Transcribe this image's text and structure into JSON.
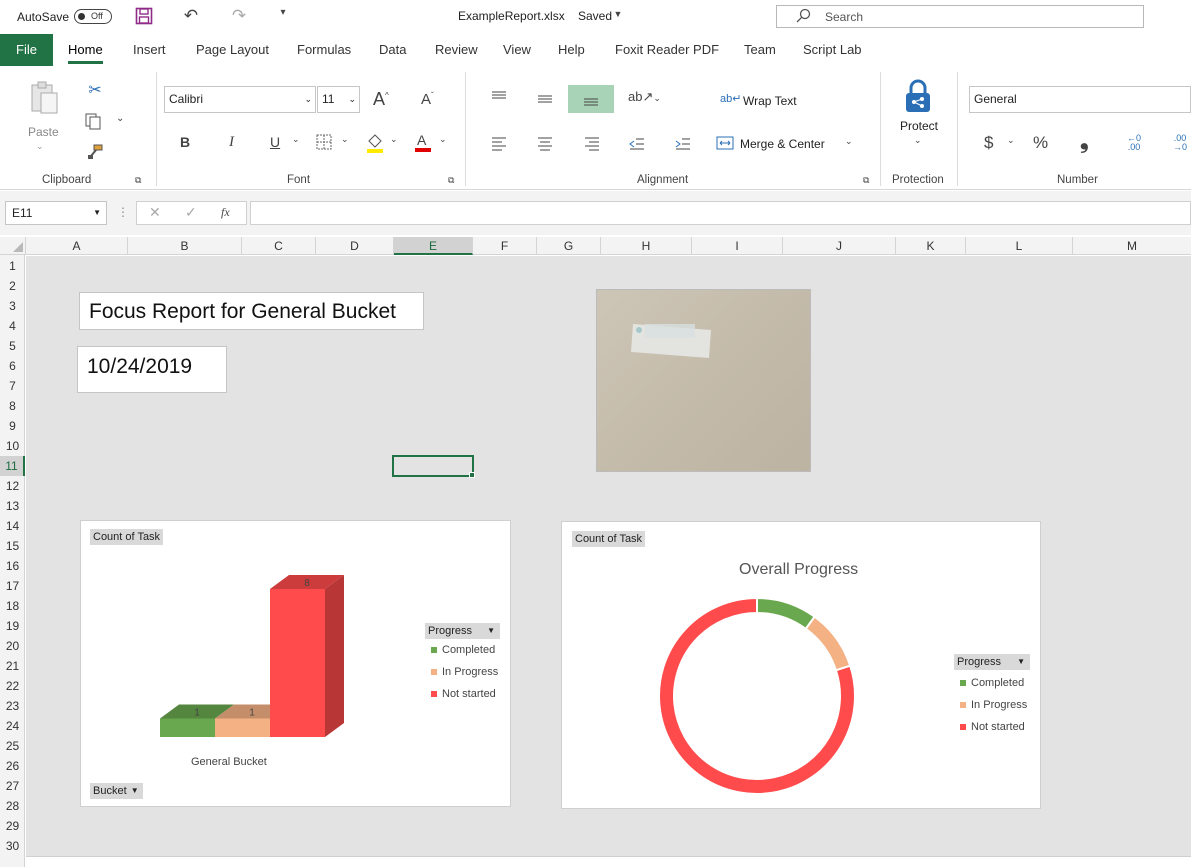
{
  "title_bar": {
    "autosave_label": "AutoSave",
    "autosave_state": "Off",
    "file_title": "ExampleReport.xlsx",
    "save_status": "Saved",
    "search_placeholder": "Search"
  },
  "ribbon_tabs": [
    "File",
    "Home",
    "Insert",
    "Page Layout",
    "Formulas",
    "Data",
    "Review",
    "View",
    "Help",
    "Foxit Reader PDF",
    "Team",
    "Script Lab"
  ],
  "ribbon": {
    "clipboard": {
      "paste_label": "Paste",
      "group_label": "Clipboard"
    },
    "font": {
      "font_name": "Calibri",
      "font_size": "11",
      "bold": "B",
      "italic": "I",
      "underline": "U",
      "group_label": "Font"
    },
    "alignment": {
      "wrap_text": "Wrap Text",
      "merge_center": "Merge & Center",
      "group_label": "Alignment"
    },
    "protection": {
      "protect_label": "Protect",
      "group_label": "Protection"
    },
    "number": {
      "format": "General",
      "group_label": "Number",
      "currency": "$",
      "percent": "%",
      "comma": "❟"
    }
  },
  "formula_bar": {
    "name_box": "E11",
    "fx": "fx",
    "formula": ""
  },
  "columns": [
    "A",
    "B",
    "C",
    "D",
    "E",
    "F",
    "G",
    "H",
    "I",
    "J",
    "K",
    "L",
    "M"
  ],
  "active_column": "E",
  "rows": [
    "1",
    "2",
    "3",
    "4",
    "5",
    "6",
    "7",
    "8",
    "9",
    "10",
    "11",
    "12",
    "13",
    "14",
    "15",
    "16",
    "17",
    "18",
    "19",
    "20",
    "21",
    "22",
    "23",
    "24",
    "25",
    "26",
    "27",
    "28",
    "29",
    "30"
  ],
  "active_row": "11",
  "sheet": {
    "report_title": "Focus Report for General Bucket",
    "report_date": "10/24/2019"
  },
  "colors": {
    "completed": "#6aa84f",
    "in_progress": "#f4b183",
    "not_started": "#ff4b4b",
    "excel_green": "#217346"
  },
  "chart_data": [
    {
      "type": "bar",
      "field_button": "Count of Task",
      "axis_field_button": "Bucket",
      "legend_field_button": "Progress",
      "categories": [
        "General Bucket"
      ],
      "series": [
        {
          "name": "Completed",
          "values": [
            1
          ]
        },
        {
          "name": "In Progress",
          "values": [
            1
          ]
        },
        {
          "name": "Not started",
          "values": [
            8
          ]
        }
      ],
      "data_labels": [
        "1",
        "1",
        "8"
      ],
      "legend": "right"
    },
    {
      "type": "pie",
      "variant": "doughnut",
      "field_button": "Count of Task",
      "title": "Overall Progress",
      "legend_field_button": "Progress",
      "labels": [
        "Completed",
        "In Progress",
        "Not started"
      ],
      "values": [
        1,
        1,
        8
      ],
      "legend": "right"
    }
  ]
}
